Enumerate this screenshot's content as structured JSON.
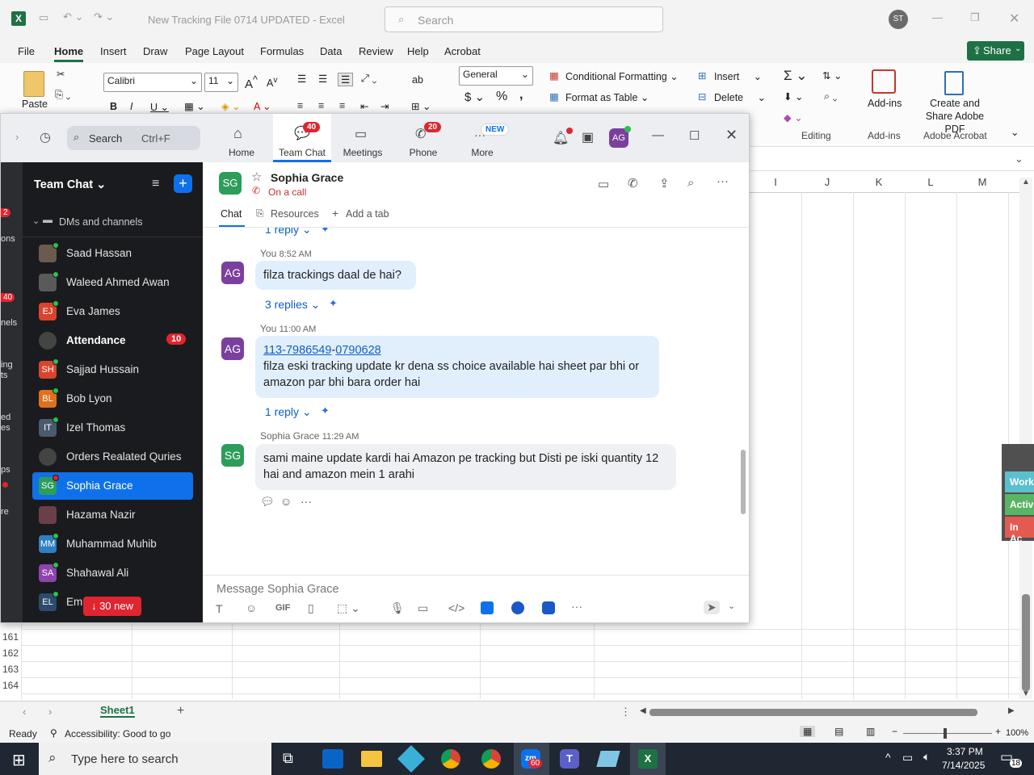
{
  "excel": {
    "title": "New Tracking File 0714 UPDATED  -  Excel",
    "search_placeholder": "Search",
    "user_initials": "ST",
    "share_label": "Share",
    "menu": [
      "File",
      "Home",
      "Insert",
      "Draw",
      "Page Layout",
      "Formulas",
      "Data",
      "Review",
      "Help",
      "Acrobat"
    ],
    "active_menu": "Home",
    "ribbon": {
      "paste": "Paste",
      "font_name": "Calibri",
      "font_size": "11",
      "number_format": "General",
      "conditional_formatting": "Conditional Formatting",
      "format_as_table": "Format as Table",
      "insert": "Insert",
      "delete": "Delete",
      "addins": "Add-ins",
      "addins_group": "Add-ins",
      "editing_group": "Editing",
      "create_share_pdf": "Create and Share Adobe PDF",
      "adobe_group": "Adobe Acrobat"
    },
    "columns": [
      "I",
      "J",
      "K",
      "L",
      "M"
    ],
    "rows": [
      "161",
      "162",
      "163",
      "164"
    ],
    "sheet_tab": "Sheet1",
    "status_ready": "Ready",
    "accessibility": "Accessibility: Good to go",
    "zoom_level": "100%",
    "side_labels": [
      "Work",
      "Activ",
      "In Ac"
    ]
  },
  "zoom": {
    "search_label": "Search",
    "search_shortcut": "Ctrl+F",
    "nav": [
      {
        "label": "Home",
        "badge": ""
      },
      {
        "label": "Team Chat",
        "badge": "40"
      },
      {
        "label": "Meetings",
        "badge": ""
      },
      {
        "label": "Phone",
        "badge": "20"
      },
      {
        "label": "More",
        "badge": "NEW"
      }
    ],
    "user_initials": "AG",
    "rail_labels": [
      "2",
      "ons",
      "40",
      "nels",
      "ing",
      "ts",
      "ed",
      "es",
      "ps",
      "re"
    ],
    "sidebar": {
      "title": "Team Chat",
      "section": "DMs and channels",
      "contacts": [
        {
          "name": "Saad Hassan",
          "initials": "",
          "color": "#6b5a4e"
        },
        {
          "name": "Waleed Ahmed Awan",
          "initials": "",
          "color": "#5a5a5a"
        },
        {
          "name": "Eva James",
          "initials": "EJ",
          "color": "#d9442f"
        },
        {
          "name": "Attendance",
          "initials": "",
          "color": "#444",
          "badge": "10"
        },
        {
          "name": "Sajjad Hussain",
          "initials": "SH",
          "color": "#d9442f"
        },
        {
          "name": "Bob Lyon",
          "initials": "BL",
          "color": "#e0701e"
        },
        {
          "name": "Izel Thomas",
          "initials": "IT",
          "color": "#4a5b6e"
        },
        {
          "name": "Orders Realated Quries",
          "initials": "",
          "color": "#444"
        },
        {
          "name": "Sophia Grace",
          "initials": "SG",
          "color": "#2d9d5a"
        },
        {
          "name": "Hazama Nazir",
          "initials": "",
          "color": "#6b3f4a"
        },
        {
          "name": "Muhammad Muhib",
          "initials": "MM",
          "color": "#2f7fc1"
        },
        {
          "name": "Shahawal Ali",
          "initials": "SA",
          "color": "#8e44ad"
        },
        {
          "name": "Em",
          "initials": "EL",
          "color": "#2c4a6e"
        }
      ],
      "new_messages": "↓ 30 new"
    },
    "chat": {
      "contact_name": "Sophia Grace",
      "contact_initials": "SG",
      "status": "On a call",
      "tabs": [
        "Chat",
        "Resources",
        "Add a tab"
      ],
      "top_replies": "1 reply",
      "messages": [
        {
          "sender": "You",
          "time": "8:52 AM",
          "initials": "AG",
          "text": "filza trackings daal de hai?",
          "replies": "3 replies"
        },
        {
          "sender": "You",
          "time": "11:00 AM",
          "initials": "AG",
          "link_a": "113-7986549",
          "link_sep": "-",
          "link_b": "0790628",
          "text": "filza eski tracking update kr dena ss choice available hai sheet par bhi or amazon par bhi bara order hai",
          "replies": "1 reply"
        },
        {
          "sender": "Sophia Grace",
          "time": "11:29 AM",
          "initials": "SG",
          "text": "sami maine update kardi hai Amazon pe tracking but Disti pe iski quantity 12 hai and amazon mein 1 arahi"
        }
      ],
      "compose_placeholder": "Message Sophia Grace"
    }
  },
  "taskbar": {
    "search_placeholder": "Type here to search",
    "time": "3:37 PM",
    "date": "7/14/2025",
    "zoom_badge": "60",
    "notif_count": "18"
  }
}
